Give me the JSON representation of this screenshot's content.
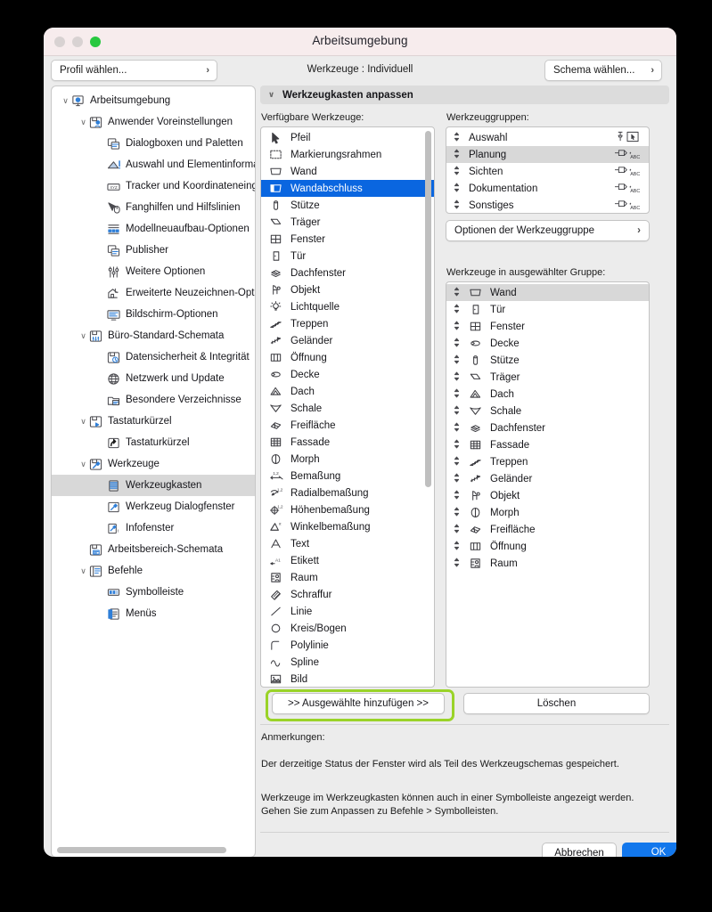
{
  "window": {
    "title": "Arbeitsumgebung",
    "traffic_lights": [
      "close-disabled",
      "minimize-disabled",
      "zoom-green"
    ]
  },
  "toolbar": {
    "profile_select": "Profil wählen...",
    "center_label": "Werkzeuge : Individuell",
    "schema_select": "Schema wählen...",
    "chevron": "›"
  },
  "sidebar": {
    "items": [
      {
        "label": "Arbeitsumgebung",
        "depth": 0,
        "twisty": "∨",
        "icon": "workspace-icon",
        "selected": false
      },
      {
        "label": "Anwender Voreinstellungen",
        "depth": 1,
        "twisty": "∨",
        "icon": "user-prefs-icon",
        "selected": false
      },
      {
        "label": "Dialogboxen und Paletten",
        "depth": 2,
        "twisty": "",
        "icon": "dialogs-icon",
        "selected": false
      },
      {
        "label": "Auswahl und Elementinformation",
        "depth": 2,
        "twisty": "",
        "icon": "selection-info-icon",
        "selected": false
      },
      {
        "label": "Tracker und Koordinateneingabe",
        "depth": 2,
        "twisty": "",
        "icon": "tracker-icon",
        "selected": false
      },
      {
        "label": "Fanghilfen und Hilfslinien",
        "depth": 2,
        "twisty": "",
        "icon": "snap-guides-icon",
        "selected": false
      },
      {
        "label": "Modellneuaufbau-Optionen",
        "depth": 2,
        "twisty": "",
        "icon": "model-rebuild-icon",
        "selected": false
      },
      {
        "label": "Publisher",
        "depth": 2,
        "twisty": "",
        "icon": "publisher-icon",
        "selected": false
      },
      {
        "label": "Weitere Optionen",
        "depth": 2,
        "twisty": "",
        "icon": "more-options-icon",
        "selected": false
      },
      {
        "label": "Erweiterte Neuzeichnen-Optione",
        "depth": 2,
        "twisty": "",
        "icon": "advanced-redraw-icon",
        "selected": false
      },
      {
        "label": "Bildschirm-Optionen",
        "depth": 2,
        "twisty": "",
        "icon": "screen-options-icon",
        "selected": false
      },
      {
        "label": "Büro-Standard-Schemata",
        "depth": 1,
        "twisty": "∨",
        "icon": "office-standards-icon",
        "selected": false
      },
      {
        "label": "Datensicherheit & Integrität",
        "depth": 2,
        "twisty": "",
        "icon": "data-safety-icon",
        "selected": false
      },
      {
        "label": "Netzwerk und Update",
        "depth": 2,
        "twisty": "",
        "icon": "network-icon",
        "selected": false
      },
      {
        "label": "Besondere Verzeichnisse",
        "depth": 2,
        "twisty": "",
        "icon": "special-folders-icon",
        "selected": false
      },
      {
        "label": "Tastaturkürzel",
        "depth": 1,
        "twisty": "∨",
        "icon": "shortcuts-group-icon",
        "selected": false
      },
      {
        "label": "Tastaturkürzel",
        "depth": 2,
        "twisty": "",
        "icon": "shortcut-icon",
        "selected": false
      },
      {
        "label": "Werkzeuge",
        "depth": 1,
        "twisty": "∨",
        "icon": "tools-group-icon",
        "selected": false
      },
      {
        "label": "Werkzeugkasten",
        "depth": 2,
        "twisty": "",
        "icon": "toolbox-icon",
        "selected": true
      },
      {
        "label": "Werkzeug Dialogfenster",
        "depth": 2,
        "twisty": "",
        "icon": "tool-dialog-icon",
        "selected": false
      },
      {
        "label": "Infofenster",
        "depth": 2,
        "twisty": "",
        "icon": "info-window-icon",
        "selected": false
      },
      {
        "label": "Arbeitsbereich-Schemata",
        "depth": 1,
        "twisty": "",
        "icon": "workspace-schemes-icon",
        "selected": false
      },
      {
        "label": "Befehle",
        "depth": 1,
        "twisty": "∨",
        "icon": "commands-icon",
        "selected": false
      },
      {
        "label": "Symbolleiste",
        "depth": 2,
        "twisty": "",
        "icon": "toolbar-icon",
        "selected": false
      },
      {
        "label": "Menüs",
        "depth": 2,
        "twisty": "",
        "icon": "menus-icon",
        "selected": false
      }
    ]
  },
  "main": {
    "section_title": "Werkzeugkasten anpassen",
    "section_twisty": "∨",
    "available_label": "Verfügbare Werkzeuge:",
    "groups_label": "Werkzeuggruppen:",
    "in_group_label": "Werkzeuge in ausgewählter Gruppe:",
    "group_options_button": "Optionen der Werkzeuggruppe",
    "group_options_chevron": "›",
    "add_button": ">> Ausgewählte hinzufügen >>",
    "delete_button": "Löschen",
    "available_tools": [
      {
        "label": "Pfeil",
        "icon": "arrow-tool-icon",
        "selected": false
      },
      {
        "label": "Markierungsrahmen",
        "icon": "marquee-tool-icon",
        "selected": false
      },
      {
        "label": "Wand",
        "icon": "wall-tool-icon",
        "selected": false
      },
      {
        "label": "Wandabschluss",
        "icon": "wall-end-tool-icon",
        "selected": true
      },
      {
        "label": "Stütze",
        "icon": "column-tool-icon",
        "selected": false
      },
      {
        "label": "Träger",
        "icon": "beam-tool-icon",
        "selected": false
      },
      {
        "label": "Fenster",
        "icon": "window-tool-icon",
        "selected": false
      },
      {
        "label": "Tür",
        "icon": "door-tool-icon",
        "selected": false
      },
      {
        "label": "Dachfenster",
        "icon": "skylight-tool-icon",
        "selected": false
      },
      {
        "label": "Objekt",
        "icon": "object-tool-icon",
        "selected": false
      },
      {
        "label": "Lichtquelle",
        "icon": "lamp-tool-icon",
        "selected": false
      },
      {
        "label": "Treppen",
        "icon": "stair-tool-icon",
        "selected": false
      },
      {
        "label": "Geländer",
        "icon": "railing-tool-icon",
        "selected": false
      },
      {
        "label": "Öffnung",
        "icon": "opening-tool-icon",
        "selected": false
      },
      {
        "label": "Decke",
        "icon": "slab-tool-icon",
        "selected": false
      },
      {
        "label": "Dach",
        "icon": "roof-tool-icon",
        "selected": false
      },
      {
        "label": "Schale",
        "icon": "shell-tool-icon",
        "selected": false
      },
      {
        "label": "Freifläche",
        "icon": "mesh-tool-icon",
        "selected": false
      },
      {
        "label": "Fassade",
        "icon": "curtainwall-tool-icon",
        "selected": false
      },
      {
        "label": "Morph",
        "icon": "morph-tool-icon",
        "selected": false
      },
      {
        "label": "Bemaßung",
        "icon": "dimension-tool-icon",
        "selected": false
      },
      {
        "label": "Radialbemaßung",
        "icon": "radial-dimension-tool-icon",
        "selected": false
      },
      {
        "label": "Höhenbemaßung",
        "icon": "level-dimension-tool-icon",
        "selected": false
      },
      {
        "label": "Winkelbemaßung",
        "icon": "angle-dimension-tool-icon",
        "selected": false
      },
      {
        "label": "Text",
        "icon": "text-tool-icon",
        "selected": false
      },
      {
        "label": "Etikett",
        "icon": "label-tool-icon",
        "selected": false
      },
      {
        "label": "Raum",
        "icon": "zone-tool-icon",
        "selected": false
      },
      {
        "label": "Schraffur",
        "icon": "fill-tool-icon",
        "selected": false
      },
      {
        "label": "Linie",
        "icon": "line-tool-icon",
        "selected": false
      },
      {
        "label": "Kreis/Bogen",
        "icon": "circle-tool-icon",
        "selected": false
      },
      {
        "label": "Polylinie",
        "icon": "polyline-tool-icon",
        "selected": false
      },
      {
        "label": "Spline",
        "icon": "spline-tool-icon",
        "selected": false
      },
      {
        "label": "Bild",
        "icon": "image-tool-icon",
        "selected": false
      }
    ],
    "tool_groups": [
      {
        "label": "Auswahl",
        "badge": "pin-pointer",
        "selected": false
      },
      {
        "label": "Planung",
        "badge": "tear-abc",
        "selected": true
      },
      {
        "label": "Sichten",
        "badge": "tear-abc",
        "selected": false
      },
      {
        "label": "Dokumentation",
        "badge": "tear-abc",
        "selected": false
      },
      {
        "label": "Sonstiges",
        "badge": "tear-abc",
        "selected": false
      }
    ],
    "group_tools": [
      {
        "label": "Wand",
        "icon": "wall-tool-icon",
        "selected": true
      },
      {
        "label": "Tür",
        "icon": "door-tool-icon",
        "selected": false
      },
      {
        "label": "Fenster",
        "icon": "window-tool-icon",
        "selected": false
      },
      {
        "label": "Decke",
        "icon": "slab-tool-icon",
        "selected": false
      },
      {
        "label": "Stütze",
        "icon": "column-tool-icon",
        "selected": false
      },
      {
        "label": "Träger",
        "icon": "beam-tool-icon",
        "selected": false
      },
      {
        "label": "Dach",
        "icon": "roof-tool-icon",
        "selected": false
      },
      {
        "label": "Schale",
        "icon": "shell-tool-icon",
        "selected": false
      },
      {
        "label": "Dachfenster",
        "icon": "skylight-tool-icon",
        "selected": false
      },
      {
        "label": "Fassade",
        "icon": "curtainwall-tool-icon",
        "selected": false
      },
      {
        "label": "Treppen",
        "icon": "stair-tool-icon",
        "selected": false
      },
      {
        "label": "Geländer",
        "icon": "railing-tool-icon",
        "selected": false
      },
      {
        "label": "Objekt",
        "icon": "object-tool-icon",
        "selected": false
      },
      {
        "label": "Morph",
        "icon": "morph-tool-icon",
        "selected": false
      },
      {
        "label": "Freifläche",
        "icon": "mesh-tool-icon",
        "selected": false
      },
      {
        "label": "Öffnung",
        "icon": "opening-tool-icon",
        "selected": false
      },
      {
        "label": "Raum",
        "icon": "zone-tool-icon",
        "selected": false
      }
    ]
  },
  "notes": {
    "heading": "Anmerkungen:",
    "line1": "Der derzeitige Status der Fenster wird als Teil des Werkzeugschemas gespeichert.",
    "line2": "Werkzeuge im Werkzeugkasten können auch in einer Symbolleiste angezeigt werden.",
    "line3": "Gehen Sie zum Anpassen zu Befehle > Symbolleisten."
  },
  "footer": {
    "cancel": "Abbrechen",
    "ok": "OK"
  },
  "colors": {
    "selection_blue": "#0a66e0",
    "ok_blue": "#1277ec",
    "highlight_green": "#9ad328",
    "titlebar_pink": "#f7eced"
  }
}
